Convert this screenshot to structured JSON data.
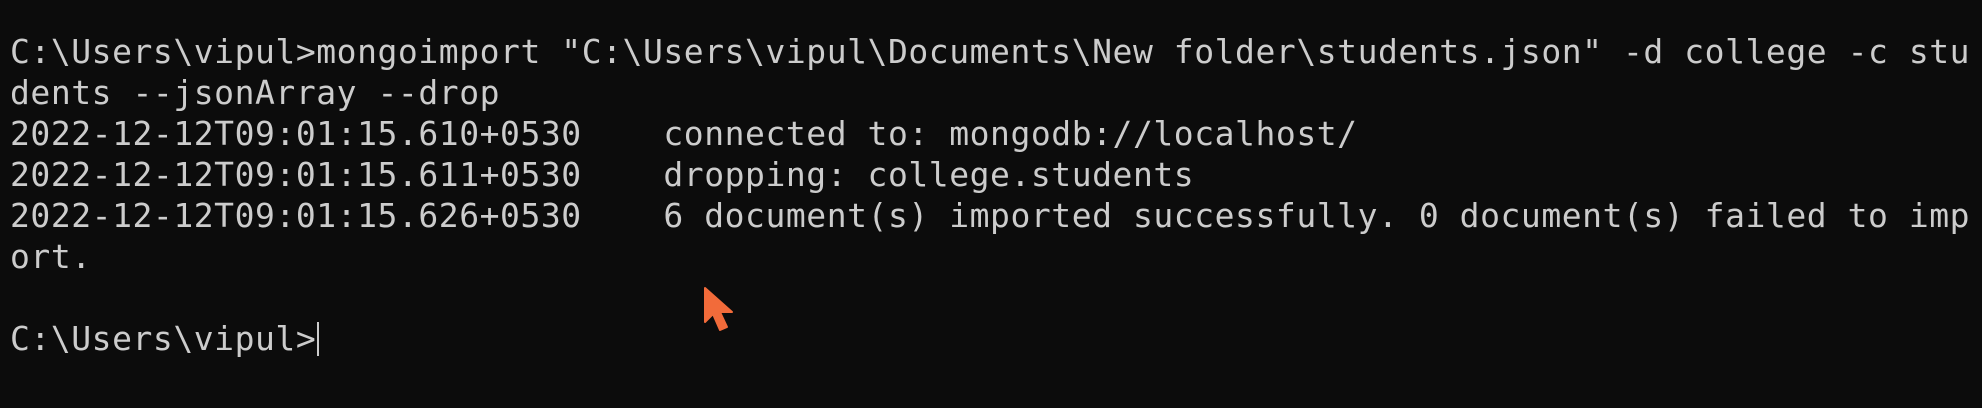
{
  "terminal": {
    "lines": [
      "C:\\Users\\vipul>mongoimport \"C:\\Users\\vipul\\Documents\\New folder\\students.json\" -d college -c stu",
      "dents --jsonArray --drop",
      "2022-12-12T09:01:15.610+0530    connected to: mongodb://localhost/",
      "2022-12-12T09:01:15.611+0530    dropping: college.students",
      "2022-12-12T09:01:15.626+0530    6 document(s) imported successfully. 0 document(s) failed to imp",
      "ort.",
      ""
    ],
    "prompt": "C:\\Users\\vipul>"
  },
  "colors": {
    "background": "#0c0c0c",
    "foreground": "#cccccc",
    "mouse_cursor": "#f26b3a"
  },
  "icons": {
    "mouse_cursor": "arrow-pointer-icon"
  }
}
